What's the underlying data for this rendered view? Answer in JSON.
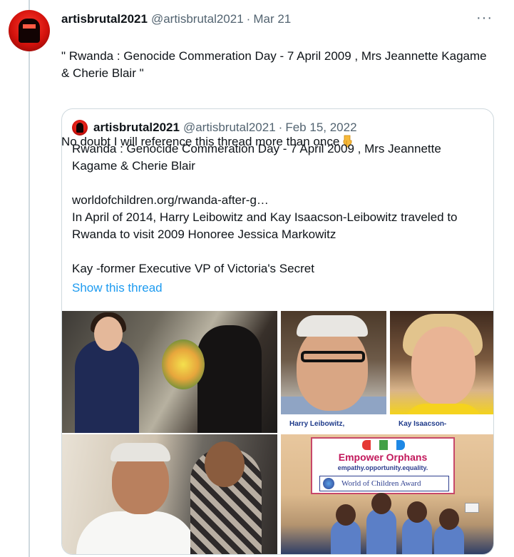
{
  "tweet": {
    "display_name": "artisbrutal2021",
    "handle": "@artisbrutal2021",
    "separator": "·",
    "date": "Mar 21",
    "more_icon": "···",
    "text_line1": "\" Rwanda : Genocide Commeration Day - 7 April 2009 , Mrs Jeannette Kagame & Cherie Blair \"",
    "text_line2": "No doubt I will reference this thread more than once",
    "emoji": "backhand-index-pointing-down"
  },
  "quote": {
    "display_name": "artisbrutal2021",
    "handle": "@artisbrutal2021",
    "separator": "·",
    "date": "Feb 15, 2022",
    "line1": "Rwanda : Genocide Commeration Day - 7 April 2009 , Mrs Jeannette Kagame & Cherie Blair",
    "link": "worldofchildren.org/rwanda-after-g…",
    "line2": "In April of 2014,  Harry Leibowitz and Kay Isaacson-Leibowitz traveled to Rwanda to visit 2009 Honoree Jessica Markowitz",
    "line3": "Kay -former Executive VP of Victoria's Secret",
    "show_thread": "Show this thread"
  },
  "media": {
    "caption_harry": "Harry Leibowitz,",
    "caption_kay": "Kay Isaacson-",
    "sign_title": "Empower Orphans",
    "sign_sub": "empathy.opportunity.equality.",
    "sign_org": "World of Children Award"
  },
  "colors": {
    "link": "#1d9bf0",
    "muted": "#536471",
    "border": "#cfd9de",
    "text": "#0f1419"
  }
}
